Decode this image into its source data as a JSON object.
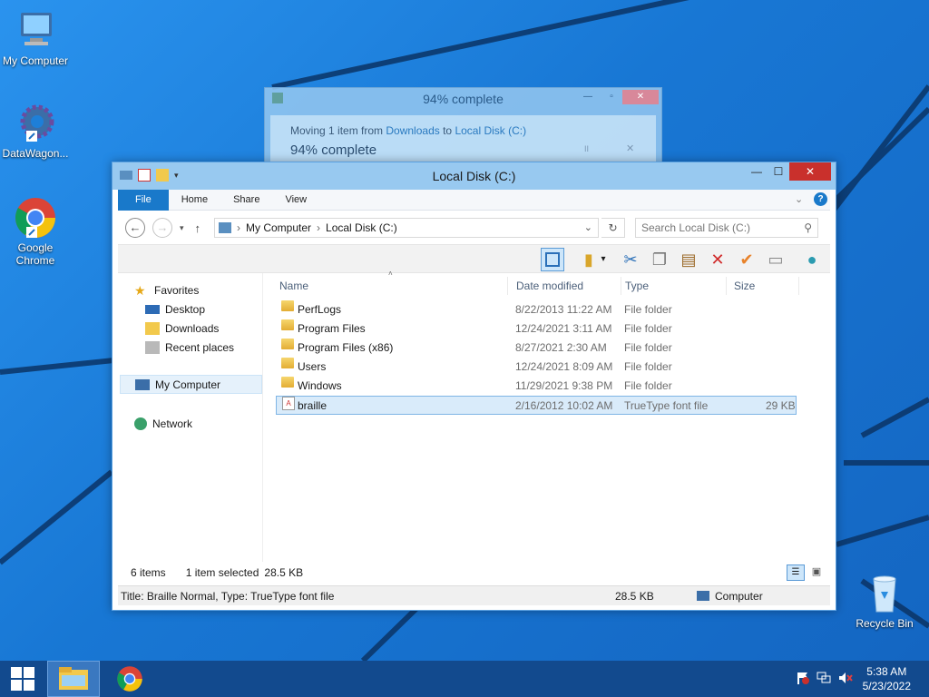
{
  "desktop": {
    "icons": [
      {
        "label": "My Computer"
      },
      {
        "label": "DataWagon..."
      },
      {
        "label": "Google Chrome"
      },
      {
        "label": "Recycle Bin"
      }
    ]
  },
  "progress_dialog": {
    "title": "94% complete",
    "moving_prefix": "Moving 1 item from",
    "from": "Downloads",
    "to_word": "to",
    "to": "Local Disk (C:)",
    "status": "94% complete",
    "pause_symbol": "II",
    "cancel_symbol": "✕"
  },
  "explorer": {
    "title": "Local Disk (C:)",
    "ribbon_tabs": [
      "File",
      "Home",
      "Share",
      "View"
    ],
    "address": {
      "root": "My Computer",
      "separator": "›",
      "current": "Local Disk (C:)"
    },
    "search_placeholder": "Search Local Disk (C:)",
    "nav": {
      "favorites": "Favorites",
      "desktop": "Desktop",
      "downloads": "Downloads",
      "recent": "Recent places",
      "computer": "My Computer",
      "network": "Network"
    },
    "columns": [
      "Name",
      "Date modified",
      "Type",
      "Size"
    ],
    "files": [
      {
        "name": "PerfLogs",
        "date": "8/22/2013 11:22 AM",
        "type": "File folder",
        "size": ""
      },
      {
        "name": "Program Files",
        "date": "12/24/2021 3:11 AM",
        "type": "File folder",
        "size": ""
      },
      {
        "name": "Program Files (x86)",
        "date": "8/27/2021 2:30 AM",
        "type": "File folder",
        "size": ""
      },
      {
        "name": "Users",
        "date": "12/24/2021 8:09 AM",
        "type": "File folder",
        "size": ""
      },
      {
        "name": "Windows",
        "date": "11/29/2021 9:38 PM",
        "type": "File folder",
        "size": ""
      },
      {
        "name": "braille",
        "date": "2/16/2012 10:02 AM",
        "type": "TrueType font file",
        "size": "29 KB"
      }
    ],
    "status": {
      "items": "6 items",
      "selected": "1 item selected",
      "selected_size": "28.5 KB"
    },
    "details": {
      "text": "Title: Braille Normal, Type: TrueType font file",
      "size": "28.5 KB",
      "location": "Computer"
    }
  },
  "taskbar": {
    "time": "5:38 AM",
    "date": "5/23/2022"
  },
  "colors": {
    "accent": "#1979ca",
    "close": "#c9302c",
    "selection": "#d9ebfa"
  }
}
